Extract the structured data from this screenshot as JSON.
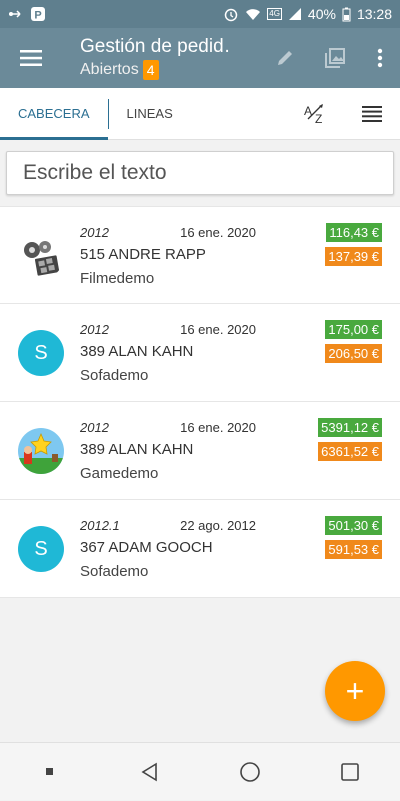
{
  "statusbar": {
    "battery": "40%",
    "time": "13:28",
    "network_badge": "4G"
  },
  "toolbar": {
    "title": "Gestión de pedid…",
    "subtitle": "Abiertos",
    "badge": "4"
  },
  "tabs": [
    {
      "label": "CABECERA",
      "active": true
    },
    {
      "label": "LINEAS",
      "active": false
    }
  ],
  "search": {
    "placeholder": "Escribe el texto"
  },
  "orders": [
    {
      "year": "2012",
      "date": "16 ene. 2020",
      "client": "515 ANDRE RAPP",
      "sub": "Filmedemo",
      "total": "116,43 €",
      "total_tax": "137,39 €",
      "avatar": "film-icon"
    },
    {
      "year": "2012",
      "date": "16 ene. 2020",
      "client": "389 ALAN KAHN",
      "sub": "Sofademo",
      "total": "175,00 €",
      "total_tax": "206,50 €",
      "avatar": "S"
    },
    {
      "year": "2012",
      "date": "16 ene. 2020",
      "client": "389 ALAN KAHN",
      "sub": "Gamedemo",
      "total": "5391,12 €",
      "total_tax": "6361,52 €",
      "avatar": "game-icon"
    },
    {
      "year": "2012.1",
      "date": "22 ago. 2012",
      "client": "367 ADAM GOOCH",
      "sub": "Sofademo",
      "total": "501,30 €",
      "total_tax": "591,53 €",
      "avatar": "S"
    }
  ],
  "fab": {
    "label": "+"
  },
  "colors": {
    "toolbar": "#6b8a99",
    "accent": "#ff9800",
    "tab_active": "#2b6f92",
    "green": "#49a93e",
    "orange": "#f0891b",
    "avatar": "#1fb8d6"
  }
}
